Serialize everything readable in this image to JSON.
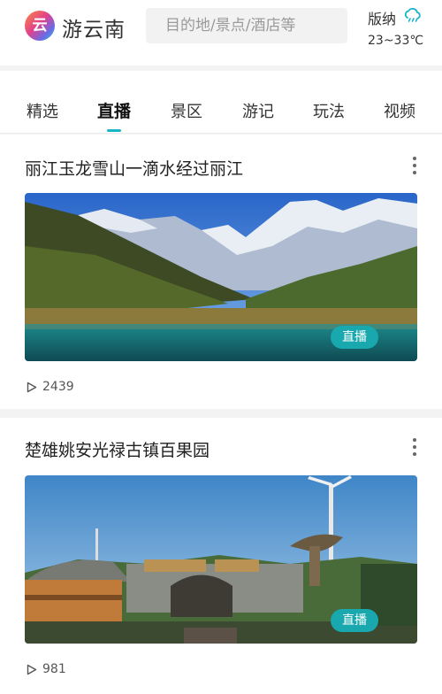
{
  "header": {
    "logo_char": "云",
    "brand": "游云南",
    "search_placeholder": "目的地/景点/酒店等",
    "weather": {
      "city": "版纳",
      "temp": "23~33℃",
      "icon": "cloud-rain-icon"
    }
  },
  "tabs": [
    {
      "label": "精选",
      "active": false
    },
    {
      "label": "直播",
      "active": true
    },
    {
      "label": "景区",
      "active": false
    },
    {
      "label": "游记",
      "active": false
    },
    {
      "label": "玩法",
      "active": false
    },
    {
      "label": "视频",
      "active": false
    }
  ],
  "feed": [
    {
      "title": "丽江玉龙雪山一滴水经过丽江",
      "badge": "直播",
      "views": "2439"
    },
    {
      "title": "楚雄姚安光禄古镇百果园",
      "badge": "直播",
      "views": "981"
    }
  ],
  "colors": {
    "accent": "#19b5c8",
    "badge": "#18a8ad"
  }
}
